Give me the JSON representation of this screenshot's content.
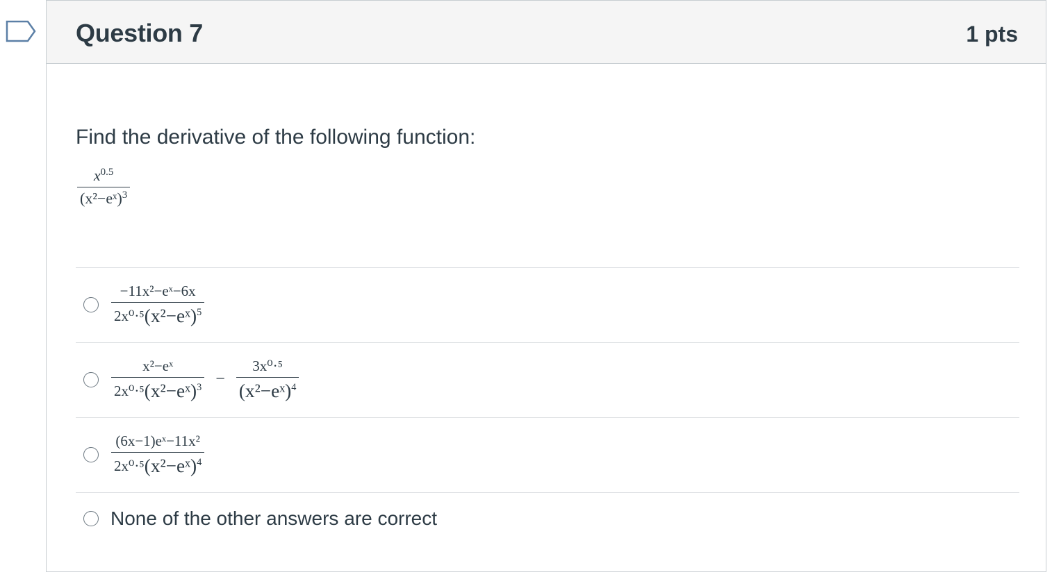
{
  "question": {
    "title": "Question 7",
    "points": "1 pts",
    "prompt": "Find the derivative of the following function:"
  },
  "function": {
    "numerator_base": "x",
    "numerator_exp": "0.5",
    "denominator": "(x²−eˣ)",
    "denominator_exp": "3"
  },
  "answers": [
    {
      "id": "a",
      "type": "math",
      "terms": [
        {
          "numerator": "−11x²−eˣ−6x",
          "denominator_prefix": "2x⁰·⁵",
          "denominator_core": "(x²−eˣ)",
          "denominator_exp": "5"
        }
      ]
    },
    {
      "id": "b",
      "type": "math",
      "terms": [
        {
          "numerator": "x²−eˣ",
          "denominator_prefix": "2x⁰·⁵",
          "denominator_core": "(x²−eˣ)",
          "denominator_exp": "3"
        },
        {
          "numerator": "3x⁰·⁵",
          "denominator_prefix": "",
          "denominator_core": "(x²−eˣ)",
          "denominator_exp": "4"
        }
      ],
      "operator": "−"
    },
    {
      "id": "c",
      "type": "math",
      "terms": [
        {
          "numerator": "(6x−1)eˣ−11x²",
          "denominator_prefix": "2x⁰·⁵",
          "denominator_core": "(x²−eˣ)",
          "denominator_exp": "4"
        }
      ]
    },
    {
      "id": "d",
      "type": "text",
      "label": "None of the other answers are correct"
    }
  ],
  "colors": {
    "text": "#2d3b45",
    "header_bg": "#f5f5f5",
    "border": "#c7cdd1",
    "flag": "#5b7fa6"
  }
}
